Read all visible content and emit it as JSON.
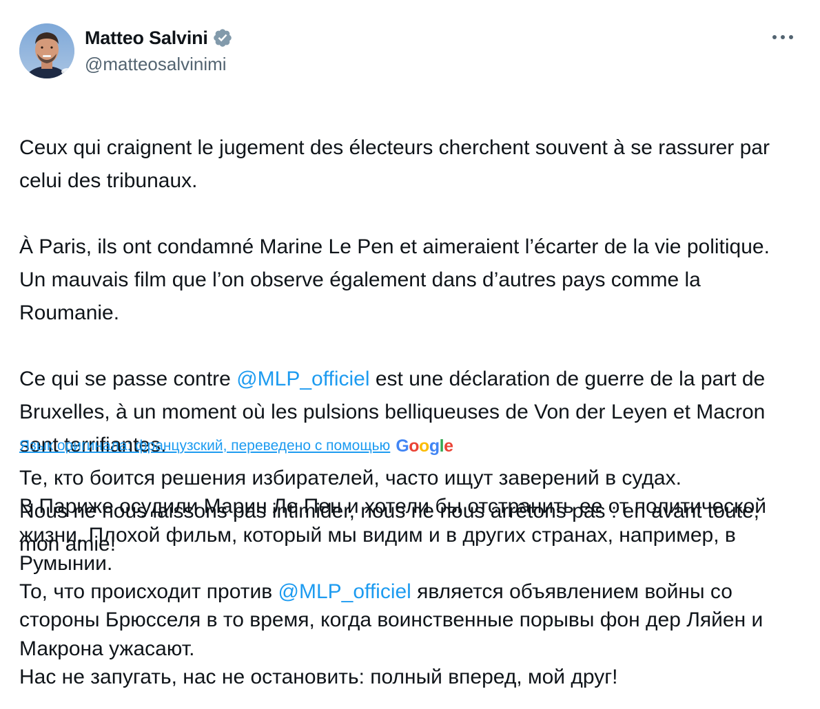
{
  "author": {
    "name": "Matteo Salvini",
    "handle": "@matteosalvinimi",
    "verified": true
  },
  "more_icon": "more-horizontal-icon",
  "tweet": {
    "original": {
      "p1": "Ceux qui craignent le jugement des électeurs cherchent souvent à se rassurer par celui des tribunaux.",
      "p2": "À Paris, ils ont condamné Marine Le Pen et aimeraient l’écarter de la vie politique. Un mauvais film que l’on observe également dans d’autres pays comme la Roumanie.",
      "p3_before": "Ce qui se passe contre ",
      "p3_mention": "@MLP_officiel",
      "p3_after": " est une déclaration de guerre de la part de Bruxelles, à un moment où les pulsions belliqueuses de Von der Leyen et Macron sont terrifiantes.",
      "p4": "Nous ne nous laissons pas intimider, nous ne nous arrêtons pas : en avant toute, mon amie!"
    },
    "translation_note": "Язык оригинала: французский, переведено с помощью",
    "translation_provider": "Google",
    "translated": {
      "p1": "Те, кто боится решения избирателей, часто ищут заверений в судах.",
      "p2": "В Париже осудили Марин Ле Пен и хотели бы отстранить ее от политической жизни. Плохой фильм, который мы видим и в других странах, например, в Румынии.",
      "p3_before": "То, что происходит против ",
      "p3_mention": "@MLP_officiel",
      "p3_after": " является объявлением войны со стороны Брюсселя в то время, когда воинственные порывы фон дер Ляйен и Макрона ужасают.",
      "p4": "Нас не запугать, нас не остановить: полный вперед, мой друг!"
    }
  },
  "colors": {
    "text": "#0f1419",
    "secondary": "#536471",
    "link": "#1d9bf0",
    "verified_badge": "#829aab",
    "google_blue": "#4285f4",
    "google_red": "#ea4335",
    "google_yellow": "#fbbc05",
    "google_green": "#34a853"
  }
}
